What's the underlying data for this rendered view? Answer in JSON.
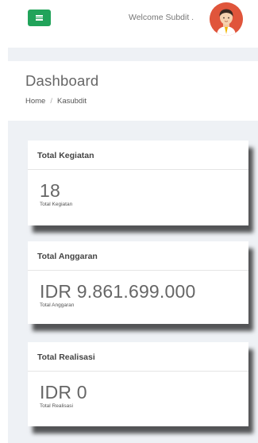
{
  "topbar": {
    "menu_icon": "hamburger-icon",
    "welcome_text": "Welcome Subdit .",
    "avatar_icon": "user-avatar-icon"
  },
  "page": {
    "title": "Dashboard",
    "breadcrumb": [
      "Home",
      "Kasubdit"
    ]
  },
  "cards": [
    {
      "header": "Total Kegiatan",
      "value": "18",
      "sub": "Total Kegiatan"
    },
    {
      "header": "Total Anggaran",
      "value": "IDR 9.861.699.000",
      "sub": "Total Anggaran"
    },
    {
      "header": "Total Realisasi",
      "value": "IDR 0",
      "sub": "Total Realisasi"
    }
  ],
  "colors": {
    "menu_button": "#21a35a",
    "avatar_bg": "#e0553b",
    "content_bg": "#eef1f5"
  }
}
